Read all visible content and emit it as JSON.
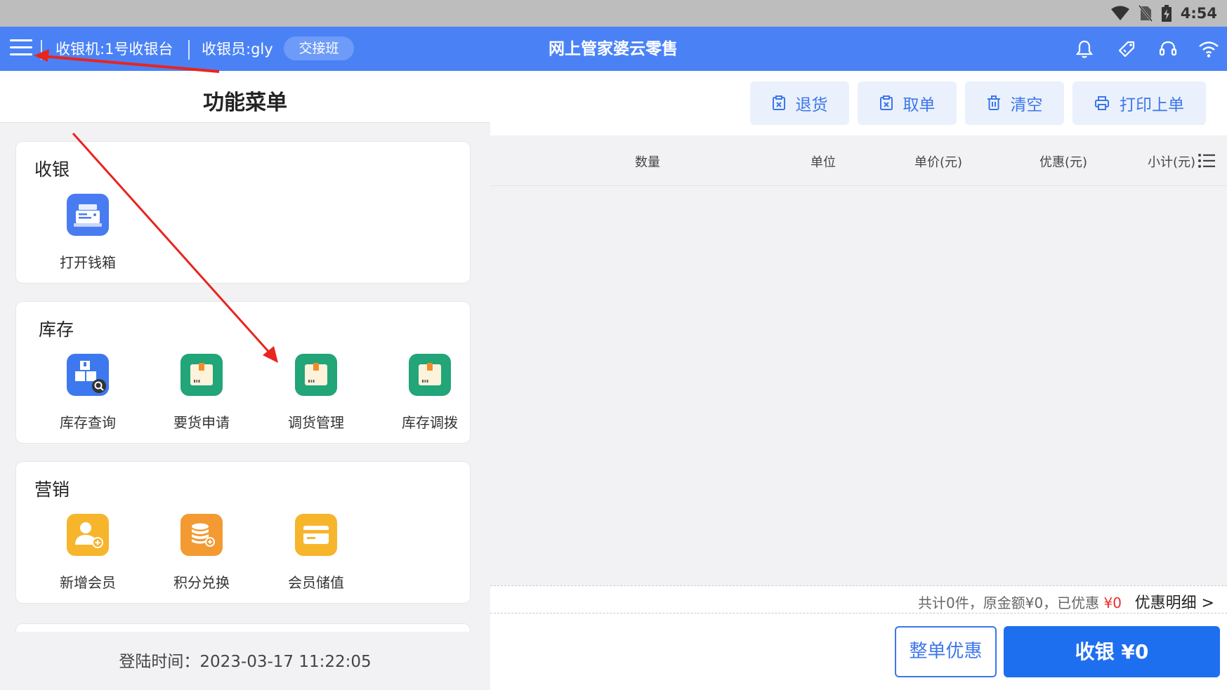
{
  "status_bar": {
    "time": "4:54",
    "icons": [
      "wifi-signal-icon",
      "no-sim-icon",
      "battery-charging-icon"
    ]
  },
  "header": {
    "register": "收银机:1号收银台",
    "cashier": "收银员:gly",
    "shift_button": "交接班",
    "title": "网上管家婆云零售",
    "icons": [
      "bell-icon",
      "tag-icon",
      "headset-icon",
      "wifi-icon"
    ]
  },
  "menu": {
    "title": "功能菜单",
    "sections": [
      {
        "title": "收银",
        "items": [
          {
            "label": "打开钱箱",
            "icon": "cash-register-icon"
          }
        ]
      },
      {
        "title": "库存",
        "items": [
          {
            "label": "库存查询",
            "icon": "inventory-search-icon"
          },
          {
            "label": "要货申请",
            "icon": "package-box-icon"
          },
          {
            "label": "调货管理",
            "icon": "package-box-icon"
          },
          {
            "label": "库存调拨",
            "icon": "package-box-icon"
          }
        ]
      },
      {
        "title": "营销",
        "items": [
          {
            "label": "新增会员",
            "icon": "add-member-icon"
          },
          {
            "label": "积分兑换",
            "icon": "points-coins-icon"
          },
          {
            "label": "会员储值",
            "icon": "stored-value-card-icon"
          }
        ]
      }
    ],
    "login_time": "登陆时间：2023-03-17 11:22:05"
  },
  "cart": {
    "toolbar": {
      "return": "退货",
      "retrieve": "取单",
      "clear": "清空",
      "print_last": "打印上单"
    },
    "columns": [
      "数量",
      "单位",
      "单价(元)",
      "优惠(元)",
      "小计(元)"
    ],
    "summary": {
      "prefix": "共计0件，原金额¥0，已优惠",
      "discount": "¥0",
      "detail_link": "优惠明细 >"
    },
    "order_discount_button": "整单优惠",
    "pay_button": "收银 ¥0"
  },
  "colors": {
    "brand_blue": "#4a82f6",
    "primary_button": "#1e6ef0",
    "discount_red": "#e8302c",
    "annotation_arrow": "#e8251f"
  }
}
